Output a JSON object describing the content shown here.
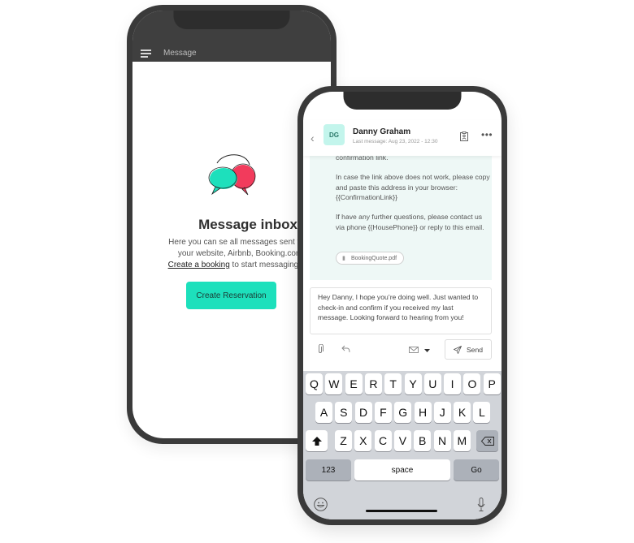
{
  "back_phone": {
    "topbar_title": "Message",
    "inbox_title": "Message inbox",
    "description_line1": "Here you can se all messages sent via emai",
    "description_line2": "your website, Airbnb, Booking.com, etc",
    "description_link": "Create a booking",
    "description_line3_rest": " to start messaging your gu",
    "create_button": "Create Reservation",
    "colors": {
      "accent": "#1de0bc",
      "bubble_teal": "#1de0bc",
      "bubble_red": "#f23b5c"
    }
  },
  "front_phone": {
    "header": {
      "avatar_initials": "DG",
      "contact_name": "Danny Graham",
      "last_message": "Last message: Aug 23, 2022 - 12:30"
    },
    "message": {
      "para1": "confirmation link.",
      "para2": "In case the link above does not work, please copy and paste this address in your browser: {{ConfirmationLink}}",
      "para3": "If have any further questions, please contact us via phone {{HousePhone}} or reply to this email.",
      "attachment": "BookingQuote.pdf"
    },
    "reply_text": "Hey Danny, I hope you’re doing well. Just wanted to check-in and confirm if you received my last message. Looking forward to hearing from you!",
    "send_label": "Send",
    "keyboard": {
      "row1": [
        "Q",
        "W",
        "E",
        "R",
        "T",
        "Y",
        "U",
        "I",
        "O",
        "P"
      ],
      "row2": [
        "A",
        "S",
        "D",
        "F",
        "G",
        "H",
        "J",
        "K",
        "L"
      ],
      "row3": [
        "Z",
        "X",
        "C",
        "V",
        "B",
        "N",
        "M"
      ],
      "numbers_key": "123",
      "space_key": "space",
      "go_key": "Go"
    }
  }
}
